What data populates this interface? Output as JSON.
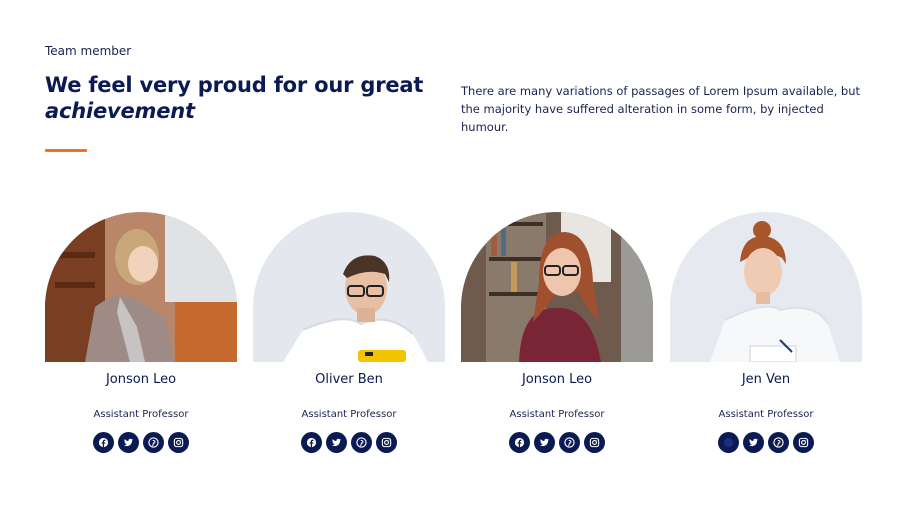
{
  "header": {
    "eyebrow": "Team member",
    "title_line1": "We feel very proud for our great",
    "title_line2": "achievement",
    "description": "There are many variations of passages of Lorem Ipsum available, but the majority have suffered alteration in some form, by injected humour.",
    "accent_color": "#f37021"
  },
  "team": [
    {
      "name": "Jonson Leo",
      "role": "Assistant Professor",
      "socials": [
        "facebook-icon",
        "twitter-icon",
        "pinterest-icon",
        "instagram-icon"
      ]
    },
    {
      "name": "Oliver Ben",
      "role": "Assistant Professor",
      "socials": [
        "facebook-icon",
        "twitter-icon",
        "pinterest-icon",
        "instagram-icon"
      ]
    },
    {
      "name": "Jonson Leo",
      "role": "Assistant Professor",
      "socials": [
        "facebook-icon",
        "twitter-icon",
        "pinterest-icon",
        "instagram-icon"
      ]
    },
    {
      "name": "Jen Ven",
      "role": "Assistant Professor",
      "socials": [
        "facebook-icon",
        "twitter-icon",
        "pinterest-icon",
        "instagram-icon"
      ]
    }
  ],
  "colors": {
    "primary": "#0b1a52",
    "accent": "#f37021",
    "background": "#ffffff"
  }
}
